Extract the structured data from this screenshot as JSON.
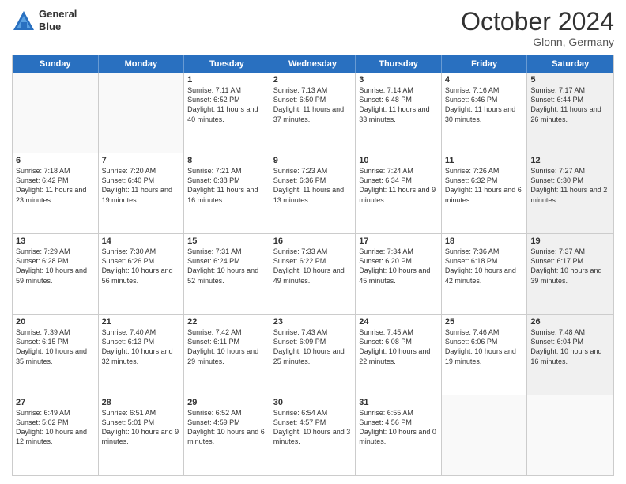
{
  "header": {
    "logo_line1": "General",
    "logo_line2": "Blue",
    "month": "October 2024",
    "location": "Glonn, Germany"
  },
  "weekdays": [
    "Sunday",
    "Monday",
    "Tuesday",
    "Wednesday",
    "Thursday",
    "Friday",
    "Saturday"
  ],
  "rows": [
    [
      {
        "day": "",
        "info": "",
        "empty": true
      },
      {
        "day": "",
        "info": "",
        "empty": true
      },
      {
        "day": "1",
        "info": "Sunrise: 7:11 AM\nSunset: 6:52 PM\nDaylight: 11 hours and 40 minutes."
      },
      {
        "day": "2",
        "info": "Sunrise: 7:13 AM\nSunset: 6:50 PM\nDaylight: 11 hours and 37 minutes."
      },
      {
        "day": "3",
        "info": "Sunrise: 7:14 AM\nSunset: 6:48 PM\nDaylight: 11 hours and 33 minutes."
      },
      {
        "day": "4",
        "info": "Sunrise: 7:16 AM\nSunset: 6:46 PM\nDaylight: 11 hours and 30 minutes."
      },
      {
        "day": "5",
        "info": "Sunrise: 7:17 AM\nSunset: 6:44 PM\nDaylight: 11 hours and 26 minutes.",
        "shaded": true
      }
    ],
    [
      {
        "day": "6",
        "info": "Sunrise: 7:18 AM\nSunset: 6:42 PM\nDaylight: 11 hours and 23 minutes."
      },
      {
        "day": "7",
        "info": "Sunrise: 7:20 AM\nSunset: 6:40 PM\nDaylight: 11 hours and 19 minutes."
      },
      {
        "day": "8",
        "info": "Sunrise: 7:21 AM\nSunset: 6:38 PM\nDaylight: 11 hours and 16 minutes."
      },
      {
        "day": "9",
        "info": "Sunrise: 7:23 AM\nSunset: 6:36 PM\nDaylight: 11 hours and 13 minutes."
      },
      {
        "day": "10",
        "info": "Sunrise: 7:24 AM\nSunset: 6:34 PM\nDaylight: 11 hours and 9 minutes."
      },
      {
        "day": "11",
        "info": "Sunrise: 7:26 AM\nSunset: 6:32 PM\nDaylight: 11 hours and 6 minutes."
      },
      {
        "day": "12",
        "info": "Sunrise: 7:27 AM\nSunset: 6:30 PM\nDaylight: 11 hours and 2 minutes.",
        "shaded": true
      }
    ],
    [
      {
        "day": "13",
        "info": "Sunrise: 7:29 AM\nSunset: 6:28 PM\nDaylight: 10 hours and 59 minutes."
      },
      {
        "day": "14",
        "info": "Sunrise: 7:30 AM\nSunset: 6:26 PM\nDaylight: 10 hours and 56 minutes."
      },
      {
        "day": "15",
        "info": "Sunrise: 7:31 AM\nSunset: 6:24 PM\nDaylight: 10 hours and 52 minutes."
      },
      {
        "day": "16",
        "info": "Sunrise: 7:33 AM\nSunset: 6:22 PM\nDaylight: 10 hours and 49 minutes."
      },
      {
        "day": "17",
        "info": "Sunrise: 7:34 AM\nSunset: 6:20 PM\nDaylight: 10 hours and 45 minutes."
      },
      {
        "day": "18",
        "info": "Sunrise: 7:36 AM\nSunset: 6:18 PM\nDaylight: 10 hours and 42 minutes."
      },
      {
        "day": "19",
        "info": "Sunrise: 7:37 AM\nSunset: 6:17 PM\nDaylight: 10 hours and 39 minutes.",
        "shaded": true
      }
    ],
    [
      {
        "day": "20",
        "info": "Sunrise: 7:39 AM\nSunset: 6:15 PM\nDaylight: 10 hours and 35 minutes."
      },
      {
        "day": "21",
        "info": "Sunrise: 7:40 AM\nSunset: 6:13 PM\nDaylight: 10 hours and 32 minutes."
      },
      {
        "day": "22",
        "info": "Sunrise: 7:42 AM\nSunset: 6:11 PM\nDaylight: 10 hours and 29 minutes."
      },
      {
        "day": "23",
        "info": "Sunrise: 7:43 AM\nSunset: 6:09 PM\nDaylight: 10 hours and 25 minutes."
      },
      {
        "day": "24",
        "info": "Sunrise: 7:45 AM\nSunset: 6:08 PM\nDaylight: 10 hours and 22 minutes."
      },
      {
        "day": "25",
        "info": "Sunrise: 7:46 AM\nSunset: 6:06 PM\nDaylight: 10 hours and 19 minutes."
      },
      {
        "day": "26",
        "info": "Sunrise: 7:48 AM\nSunset: 6:04 PM\nDaylight: 10 hours and 16 minutes.",
        "shaded": true
      }
    ],
    [
      {
        "day": "27",
        "info": "Sunrise: 6:49 AM\nSunset: 5:02 PM\nDaylight: 10 hours and 12 minutes."
      },
      {
        "day": "28",
        "info": "Sunrise: 6:51 AM\nSunset: 5:01 PM\nDaylight: 10 hours and 9 minutes."
      },
      {
        "day": "29",
        "info": "Sunrise: 6:52 AM\nSunset: 4:59 PM\nDaylight: 10 hours and 6 minutes."
      },
      {
        "day": "30",
        "info": "Sunrise: 6:54 AM\nSunset: 4:57 PM\nDaylight: 10 hours and 3 minutes."
      },
      {
        "day": "31",
        "info": "Sunrise: 6:55 AM\nSunset: 4:56 PM\nDaylight: 10 hours and 0 minutes."
      },
      {
        "day": "",
        "info": "",
        "empty": true
      },
      {
        "day": "",
        "info": "",
        "empty": true
      }
    ]
  ]
}
